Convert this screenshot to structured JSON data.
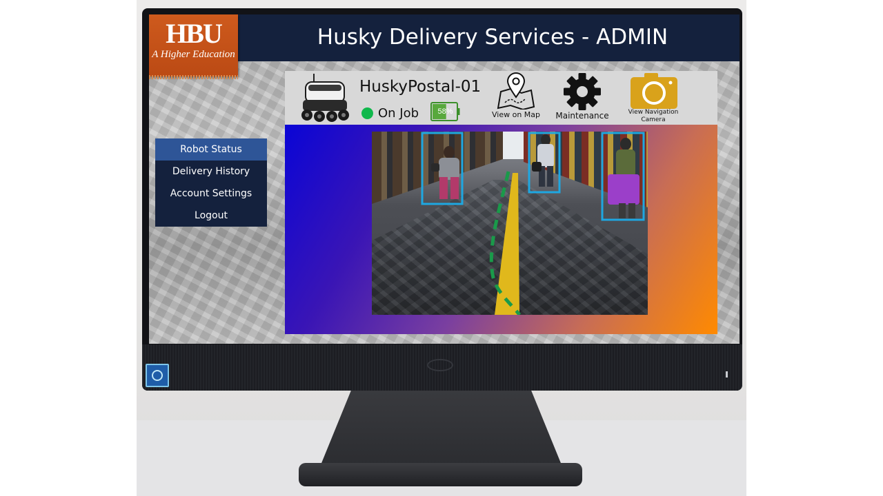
{
  "app": {
    "title": "Husky Delivery Services - ADMIN",
    "logo_mark": "HBU",
    "logo_tagline": "A Higher Education"
  },
  "sidebar": {
    "items": [
      {
        "label": "Robot Status",
        "active": true
      },
      {
        "label": "Delivery History",
        "active": false
      },
      {
        "label": "Account Settings",
        "active": false
      },
      {
        "label": "Logout",
        "active": false
      }
    ]
  },
  "robot": {
    "name": "HuskyPostal-01",
    "status": "On Job",
    "status_color": "#10b84c",
    "battery": "58%",
    "battery_level": 0.58,
    "battery_color": "#3b8f2a"
  },
  "actions": {
    "map_label": "View on Map",
    "maintenance_label": "Maintenance",
    "camera_label": "View Navigation Camera"
  },
  "icons": {
    "robot": "delivery-robot-icon",
    "map": "map-pin-icon",
    "maintenance": "gear-icon",
    "camera": "camera-icon"
  },
  "colors": {
    "header": "#14213d",
    "menu_active": "#2e5597",
    "detection_box": "#1ea7e1",
    "path_line": "#1a9a4a",
    "camera_icon": "#d9a21b"
  }
}
